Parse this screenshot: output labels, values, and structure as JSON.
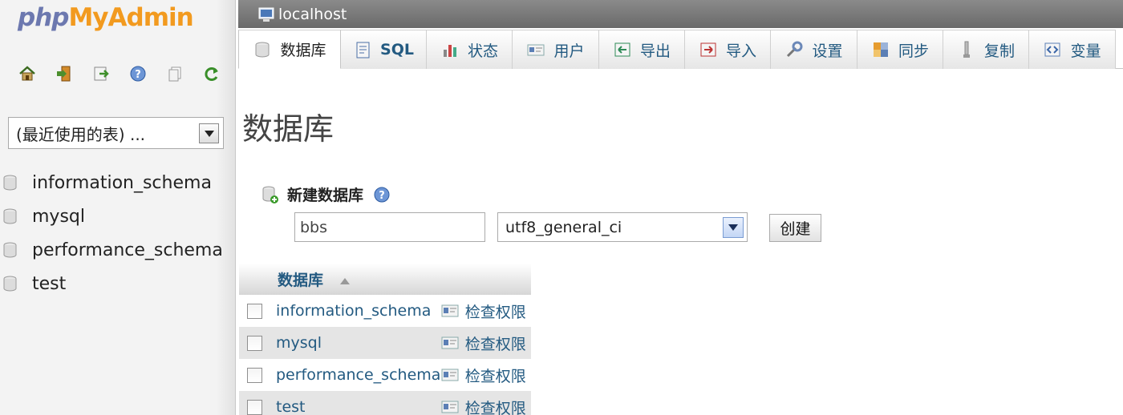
{
  "sidebar": {
    "logo_php": "php",
    "logo_rest": "MyAdmin",
    "nav_icons": [
      "home-icon",
      "logout-icon",
      "query-window-icon",
      "documentation-icon",
      "copy-icon",
      "reload-icon"
    ],
    "recent_tables": "(最近使用的表) ...",
    "databases": [
      "information_schema",
      "mysql",
      "performance_schema",
      "test"
    ]
  },
  "topbar": {
    "server": "localhost"
  },
  "tabs": [
    {
      "label": "数据库",
      "icon": "database-icon",
      "active": true
    },
    {
      "label": "SQL",
      "icon": "sql-icon"
    },
    {
      "label": "状态",
      "icon": "status-icon"
    },
    {
      "label": "用户",
      "icon": "users-icon"
    },
    {
      "label": "导出",
      "icon": "export-icon"
    },
    {
      "label": "导入",
      "icon": "import-icon"
    },
    {
      "label": "设置",
      "icon": "settings-icon"
    },
    {
      "label": "同步",
      "icon": "sync-icon"
    },
    {
      "label": "复制",
      "icon": "replication-icon"
    },
    {
      "label": "变量",
      "icon": "variables-icon"
    }
  ],
  "main": {
    "title": "数据库",
    "create_label": "新建数据库",
    "db_name_value": "bbs",
    "collation_value": "utf8_general_ci",
    "create_button": "创建"
  },
  "table": {
    "header": "数据库",
    "rows": [
      {
        "name": "information_schema",
        "action": "检查权限"
      },
      {
        "name": "mysql",
        "action": "检查权限"
      },
      {
        "name": "performance_schema",
        "action": "检查权限"
      },
      {
        "name": "test",
        "action": "检查权限"
      }
    ]
  },
  "colors": {
    "link": "#235a81",
    "logo_php": "#6c78af",
    "logo_accent": "#f29a1f",
    "topbar": "#7a7a7a"
  }
}
